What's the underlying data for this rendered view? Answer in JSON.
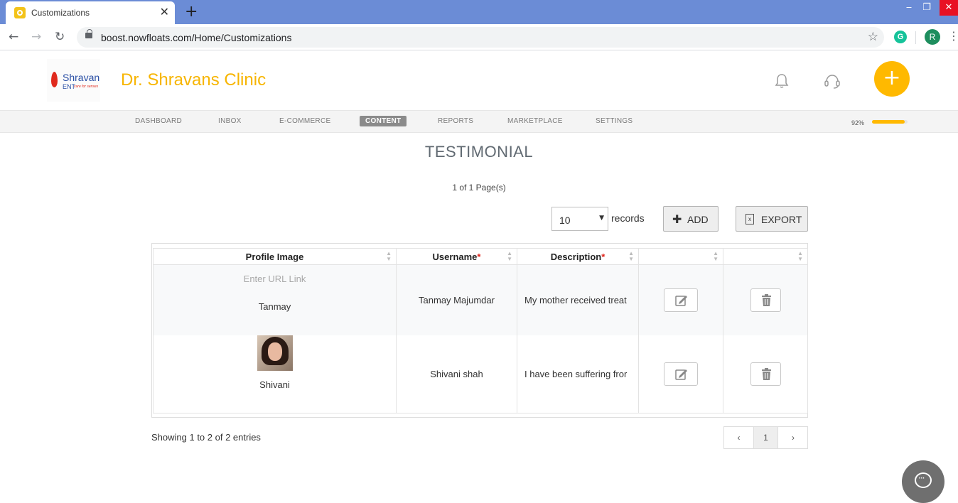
{
  "browser": {
    "tab_title": "Customizations",
    "tab_close": "✕",
    "new_tab": "+",
    "url": "boost.nowfloats.com/Home/Customizations",
    "profile_initial": "R",
    "ext_initial": "G",
    "win_min": "‒",
    "win_max": "❐",
    "win_close": "✕"
  },
  "header": {
    "logo_line1": "Shravan",
    "logo_line2": "ENT",
    "logo_tagline": "care for senses",
    "clinic_name": "Dr. Shravans Clinic",
    "add_glyph": "+",
    "brand_color": "#f7b500"
  },
  "nav": {
    "items": [
      "DASHBOARD",
      "INBOX",
      "E-COMMERCE",
      "CONTENT",
      "REPORTS",
      "MARKETPLACE",
      "SETTINGS"
    ],
    "active": "CONTENT",
    "completion_label": "92%",
    "completion": 0.92
  },
  "page": {
    "title": "TESTIMONIAL",
    "page_count": "1 of 1 Page(s)",
    "records_value": "10",
    "records_label": "records",
    "add_label": "ADD",
    "export_label": "EXPORT"
  },
  "table": {
    "columns": [
      "Profile Image",
      "Username",
      "Description",
      "",
      ""
    ],
    "required_marker": "*",
    "rows": [
      {
        "url_placeholder": "Enter URL Link",
        "profile_name": "Tanmay",
        "username": "Tanmay Majumdar",
        "description": "My mother received treat"
      },
      {
        "profile_name": "Shivani",
        "username": "Shivani shah",
        "description": "I have been suffering fror"
      }
    ]
  },
  "footer": {
    "showing": "Showing 1 to 2 of 2 entries",
    "pager_prev": "‹",
    "pager_current": "1",
    "pager_next": "›"
  }
}
